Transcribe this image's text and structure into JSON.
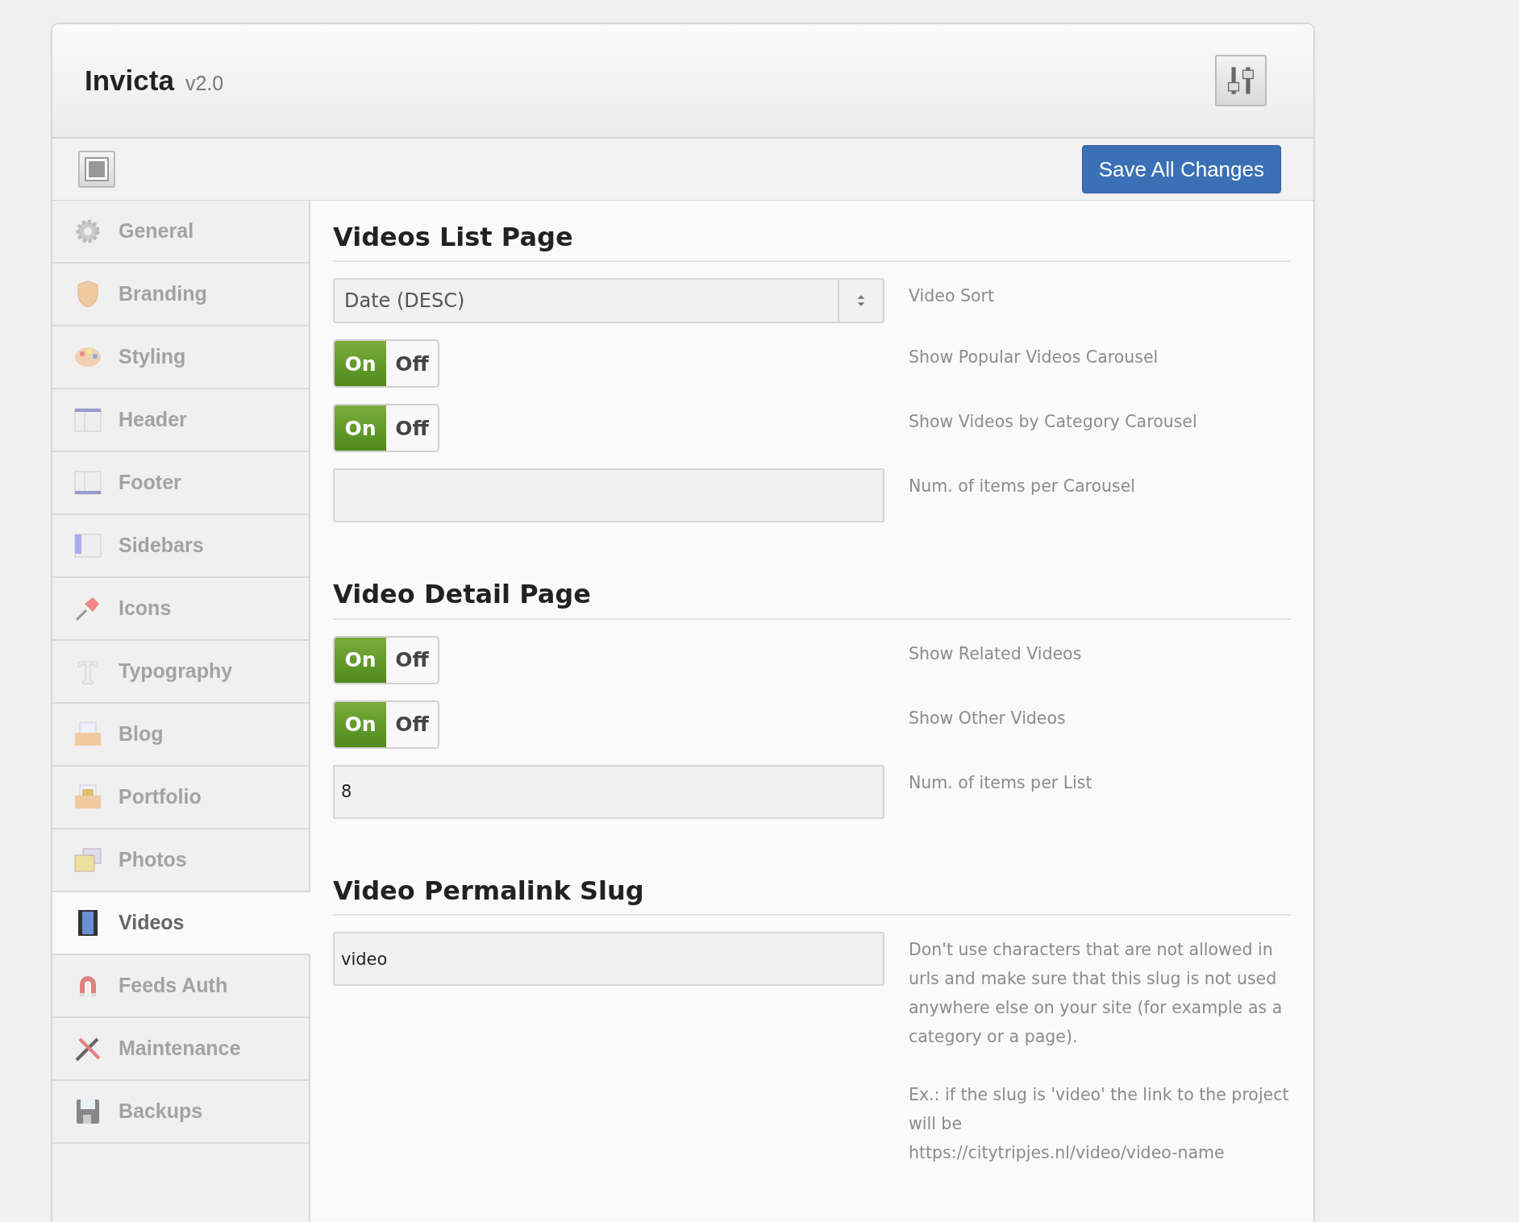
{
  "header": {
    "title": "Invicta",
    "version": "v2.0"
  },
  "toolbar": {
    "save_button": "Save All Changes"
  },
  "sidebar": {
    "items": [
      {
        "label": "General",
        "selected": false
      },
      {
        "label": "Branding",
        "selected": false
      },
      {
        "label": "Styling",
        "selected": false
      },
      {
        "label": "Header",
        "selected": false
      },
      {
        "label": "Footer",
        "selected": false
      },
      {
        "label": "Sidebars",
        "selected": false
      },
      {
        "label": "Icons",
        "selected": false
      },
      {
        "label": "Typography",
        "selected": false
      },
      {
        "label": "Blog",
        "selected": false
      },
      {
        "label": "Portfolio",
        "selected": false
      },
      {
        "label": "Photos",
        "selected": false
      },
      {
        "label": "Videos",
        "selected": true
      },
      {
        "label": "Feeds Auth",
        "selected": false
      },
      {
        "label": "Maintenance",
        "selected": false
      },
      {
        "label": "Backups",
        "selected": false
      }
    ]
  },
  "sections": [
    {
      "title": "Videos List Page",
      "options": [
        {
          "kind": "select",
          "value": "Date (DESC)",
          "label": "Video Sort"
        },
        {
          "kind": "toggle",
          "on": true,
          "on_text": "On",
          "off_text": "Off",
          "label": "Show Popular Videos Carousel"
        },
        {
          "kind": "toggle",
          "on": true,
          "on_text": "On",
          "off_text": "Off",
          "label": "Show Videos by Category Carousel"
        },
        {
          "kind": "text",
          "label": "Num. of items per Carousel"
        }
      ]
    },
    {
      "title": "Video Detail Page",
      "options": [
        {
          "kind": "toggle",
          "on": true,
          "on_text": "On",
          "off_text": "Off",
          "label": "Show Related Videos"
        },
        {
          "kind": "toggle",
          "on": true,
          "on_text": "On",
          "off_text": "Off",
          "label": "Show Other Videos"
        },
        {
          "kind": "text",
          "value": "8",
          "label": "Num. of items per List"
        }
      ]
    },
    {
      "title": "Video Permalink Slug",
      "options": [
        {
          "kind": "text",
          "value": "video",
          "description": [
            "Don't use characters that are not allowed in urls and make sure that this slug is not used anywhere else on your site (for example as a category or a page).",
            "Ex.: if the slug is 'video' the link to the project will be",
            "https://citytripjes.nl/video/video-name"
          ]
        }
      ]
    }
  ]
}
